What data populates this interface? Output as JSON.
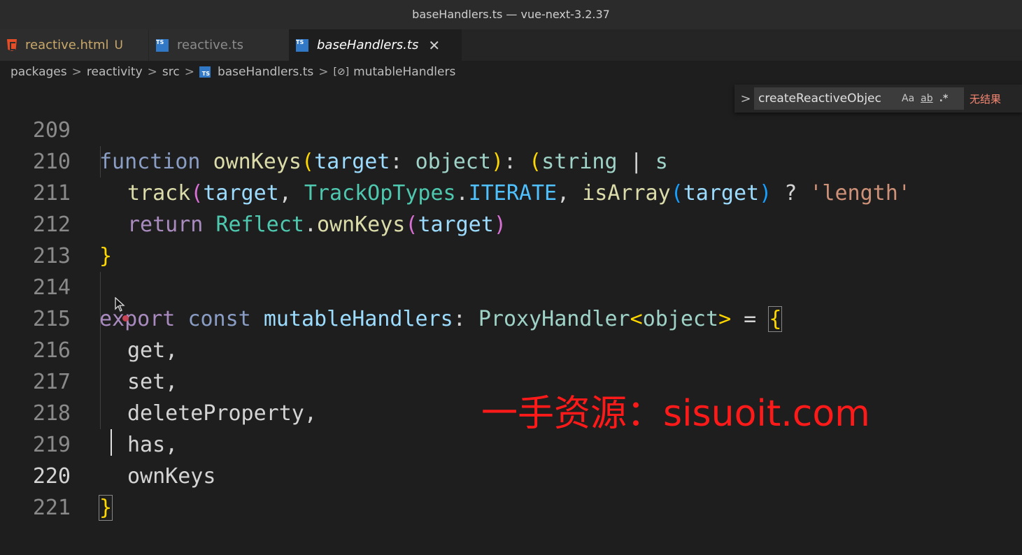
{
  "window": {
    "title": "baseHandlers.ts — vue-next-3.2.37"
  },
  "tabs": [
    {
      "label": "reactive.html",
      "modified": "U",
      "icon": "html-file-icon"
    },
    {
      "label": "reactive.ts",
      "icon": "typescript-file-icon"
    },
    {
      "label": "baseHandlers.ts",
      "icon": "typescript-file-icon",
      "close": "✕"
    }
  ],
  "breadcrumb": {
    "items": [
      "packages",
      "reactivity",
      "src",
      "baseHandlers.ts",
      "mutableHandlers"
    ],
    "separator": ">",
    "ts_badge": "TS",
    "symbol_glyph": "[⊘]"
  },
  "find_widget": {
    "toggle": ">",
    "query": "createReactiveObjec",
    "match_case": "Aa",
    "whole_word": "ab",
    "regex": ".*",
    "result": "无结果"
  },
  "editor": {
    "line_numbers": [
      "209",
      "210",
      "211",
      "212",
      "213",
      "214",
      "215",
      "216",
      "217",
      "218",
      "219",
      "220",
      "221"
    ],
    "current_line": "220",
    "lines": {
      "l209": {
        "t0": "function",
        "t1": " ",
        "t2": "ownKeys",
        "t3": "(",
        "t4": "target",
        "t5": ": ",
        "t6": "object",
        "t7": ")",
        "t8": ": ",
        "t9": "(",
        "t10": "string",
        "t11": " | ",
        "t12": "s"
      },
      "l210": {
        "t0": "track",
        "t1": "(",
        "t2": "target",
        "t3": ", ",
        "t4": "TrackOpTypes",
        "t5": ".",
        "t6": "ITERATE",
        "t7": ", ",
        "t8": "isArray",
        "t9": "(",
        "t10": "target",
        "t11": ")",
        "t12": " ? ",
        "t13": "'length'"
      },
      "l211": {
        "t0": "return",
        "t1": " ",
        "t2": "Reflect",
        "t3": ".",
        "t4": "ownKeys",
        "t5": "(",
        "t6": "target",
        "t7": ")"
      },
      "l212": {
        "t0": "}"
      },
      "l214": {
        "t0": "export",
        "t1": " ",
        "t2": "const",
        "t3": " ",
        "t4": "mutableHandlers",
        "t5": ": ",
        "t6": "ProxyHandler",
        "t7": "<",
        "t8": "object",
        "t9": ">",
        "t10": " = ",
        "t11": "{"
      },
      "l215": {
        "t0": "get,"
      },
      "l216": {
        "t0": "set,"
      },
      "l217": {
        "t0": "deleteProperty,"
      },
      "l218": {
        "t0": "has,"
      },
      "l219": {
        "t0": "ownKeys"
      },
      "l220": {
        "t0": "}"
      }
    }
  },
  "watermark": "一手资源：sisuoit.com",
  "colors": {
    "keyword": "#a98bbf",
    "function": "#dcdcaa",
    "variable": "#9cdcfe",
    "type": "#4ec9b0",
    "string": "#ce9178",
    "watermark": "#ff1a1a"
  }
}
